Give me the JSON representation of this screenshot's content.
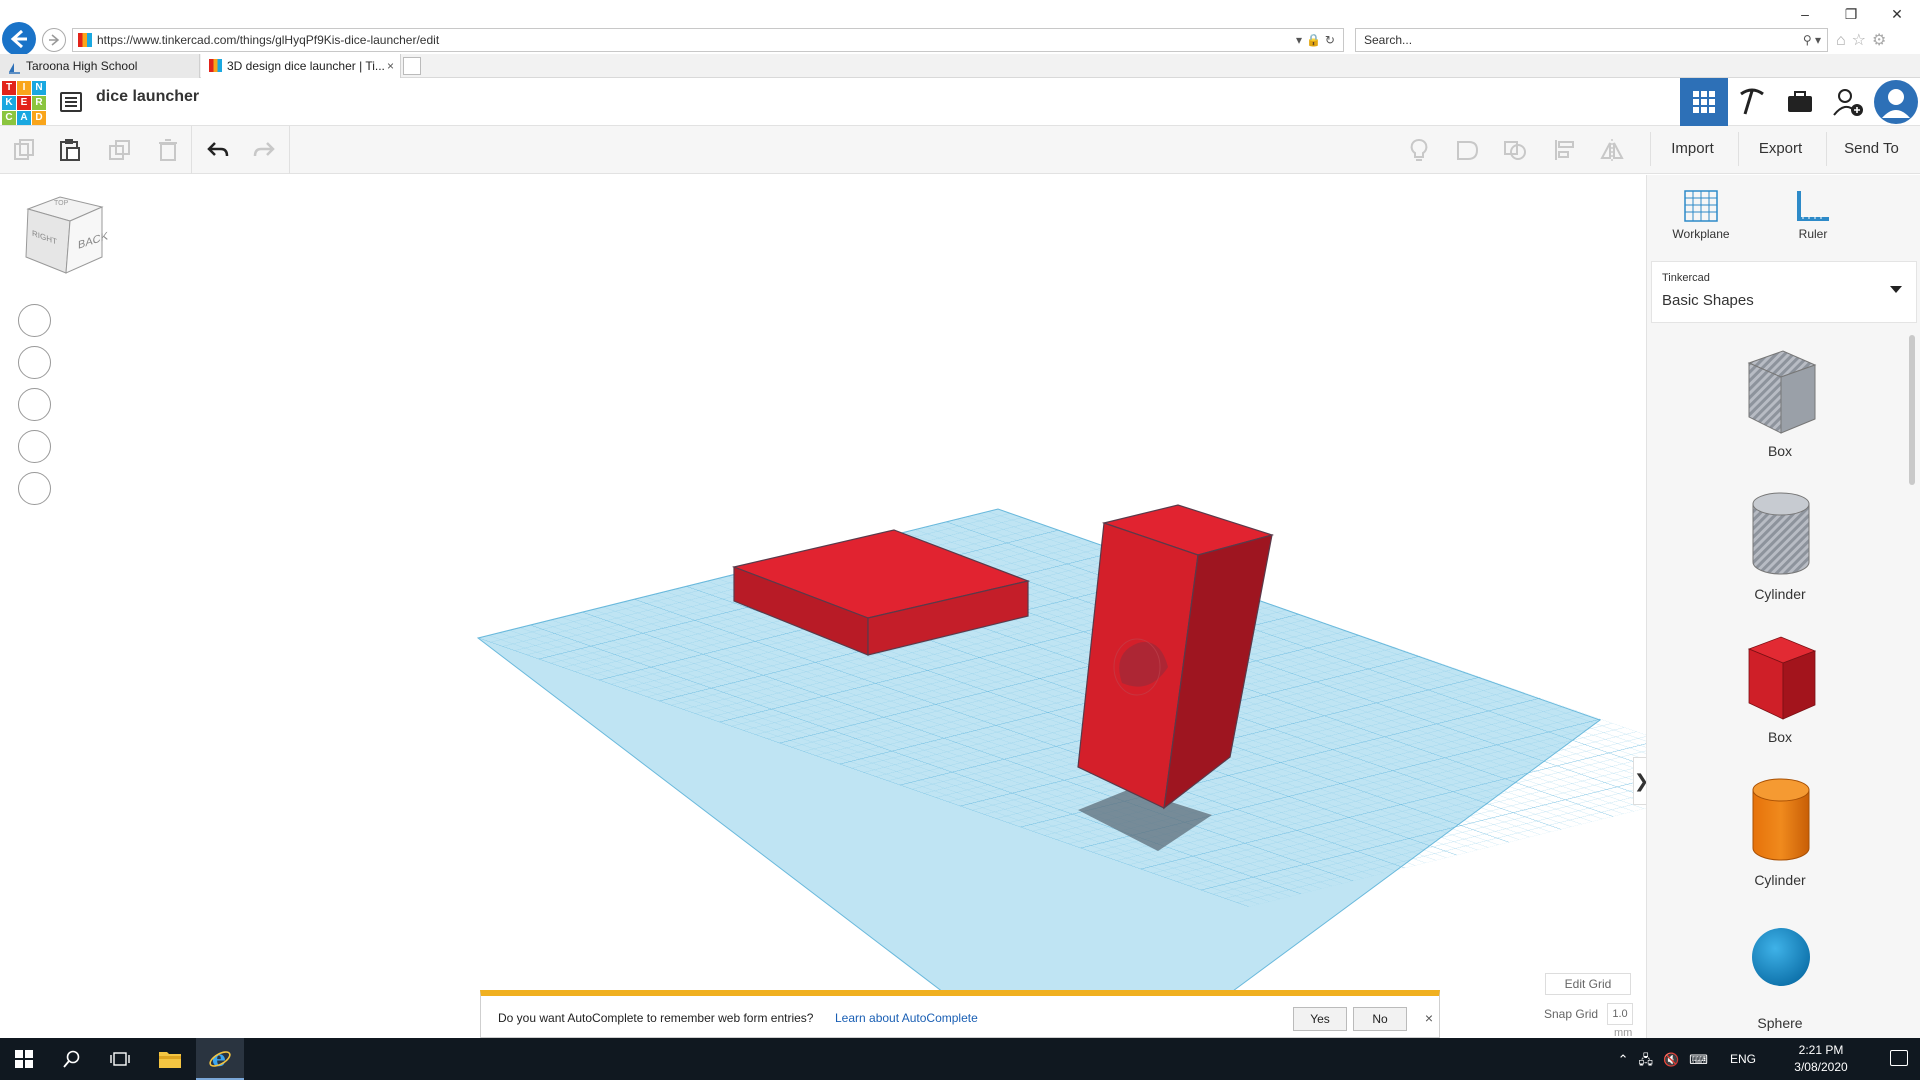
{
  "browser": {
    "url": "https://www.tinkercad.com/things/glHyqPf9Kis-dice-launcher/edit",
    "search_placeholder": "Search...",
    "tabs": [
      {
        "label": "Taroona High School"
      },
      {
        "label": "3D design dice launcher | Ti..."
      }
    ],
    "win_minimize": "–",
    "win_restore": "❐",
    "win_close": "✕",
    "tab_close": "×"
  },
  "app": {
    "logo_letters": [
      "T",
      "I",
      "N",
      "K",
      "E",
      "R",
      "C",
      "A",
      "D"
    ],
    "design_title": "dice launcher"
  },
  "toolbar": {
    "import_label": "Import",
    "export_label": "Export",
    "send_to_label": "Send To"
  },
  "viewcube": {
    "face_front": "BACK",
    "face_side": "RIGHT",
    "face_top": "TOP"
  },
  "grid": {
    "edit_grid_label": "Edit Grid",
    "snap_grid_label": "Snap Grid",
    "snap_grid_value": "1.0",
    "snap_grid_unit": "mm"
  },
  "side_panel": {
    "workplane_label": "Workplane",
    "ruler_label": "Ruler",
    "library_provider": "Tinkercad",
    "library_name": "Basic Shapes",
    "shapes": [
      {
        "label": "Box"
      },
      {
        "label": "Cylinder"
      },
      {
        "label": "Box"
      },
      {
        "label": "Cylinder"
      },
      {
        "label": "Sphere"
      }
    ],
    "panel_toggle": "❯"
  },
  "autocomplete": {
    "message": "Do you want AutoComplete to remember web form entries?",
    "link": "Learn about AutoComplete",
    "yes": "Yes",
    "no": "No",
    "close": "×"
  },
  "taskbar": {
    "language": "ENG",
    "time": "2:21 PM",
    "date": "3/08/2020"
  },
  "colors": {
    "accent_blue": "#2d70b7",
    "shape_red": "#d41f27",
    "grid_blue": "#9fd4ec",
    "autocomplete_bar": "#f0b020"
  }
}
